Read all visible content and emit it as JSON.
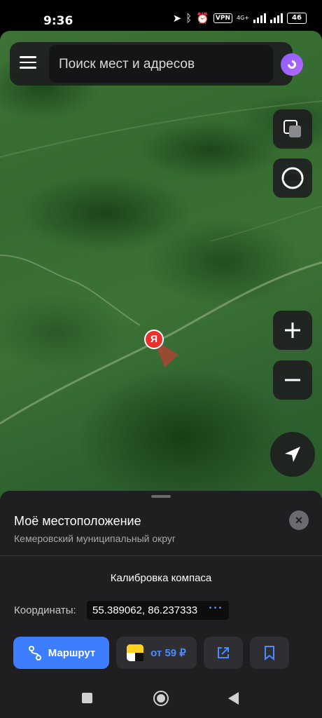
{
  "status_bar": {
    "time": "9:36",
    "vpn": "VPN",
    "network": "4G+",
    "battery": "46"
  },
  "search": {
    "placeholder": "Поиск мест и адресов"
  },
  "map": {
    "pin_letter": "Я",
    "type": "satellite"
  },
  "place_card": {
    "title": "Моё местоположение",
    "subtitle": "Кемеровский муниципальный округ",
    "calibration": "Калибровка компаса",
    "coordinates_label": "Координаты:",
    "coordinates_value": "55.389062, 86.237333",
    "more": "···"
  },
  "actions": {
    "route_label": "Маршрут",
    "taxi_label": "от 59 ₽"
  },
  "colors": {
    "accent": "#3d7dff",
    "pin": "#e8312f",
    "sheet_bg": "#1f1f22"
  },
  "icons": [
    "menu-icon",
    "alice-icon",
    "layers-icon",
    "compass-icon",
    "zoom-in-icon",
    "zoom-out-icon",
    "location-arrow-icon",
    "close-icon",
    "route-icon",
    "taxi-icon",
    "share-icon",
    "bookmark-icon"
  ]
}
